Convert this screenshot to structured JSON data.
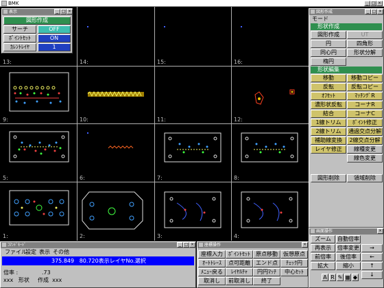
{
  "app": {
    "title": "BMK"
  },
  "canvas": {
    "cell_numbers": [
      "13:",
      "14:",
      "15:",
      "16:",
      "9:",
      "10:",
      "11:",
      "12:",
      "5:",
      "6:",
      "7:",
      "8:",
      "1:",
      "2:",
      "3:",
      "4:"
    ]
  },
  "zone_panel": {
    "title": "表示",
    "header": "図形作成",
    "rows": [
      {
        "label": "サーチ",
        "value": "OFF"
      },
      {
        "label": "ﾎﾟｲﾝﾄｾｯﾄ",
        "value": "ON"
      },
      {
        "label": "ｶﾚﾝﾄﾚｲﾔ",
        "value": "1"
      }
    ]
  },
  "shape_panel": {
    "title": "図形作成",
    "mode_label": "モード",
    "section1": "形状作成",
    "buttons1": [
      [
        "図形作成",
        "UT"
      ],
      [
        "円",
        "四角形"
      ],
      [
        "同心円",
        "形状分解"
      ],
      [
        "楕円",
        ""
      ]
    ],
    "section2": "形状編集",
    "buttons2": [
      [
        "移動",
        "移動コピー"
      ],
      [
        "反転",
        "反転コピー"
      ],
      [
        "ｵﾌｾｯﾄ",
        "ﾏｯﾁﾝｸﾞR"
      ],
      [
        "濃形状反転",
        "コーナR"
      ],
      [
        "結合",
        "コーナC"
      ],
      [
        "1線トリム",
        "ﾎﾟｲﾝﾄ修正"
      ],
      [
        "2線トリム",
        "通過交点分解"
      ],
      [
        "補助線変換",
        "2線交点分解"
      ],
      [
        "レイヤ修正",
        "線種変更"
      ],
      [
        "",
        "線色変更"
      ]
    ],
    "bottom_buttons": [
      "図形削除",
      "領域削除"
    ]
  },
  "screen_panel": {
    "title": "画面操作",
    "buttons": [
      [
        "ズーム",
        "自動倍率"
      ],
      [
        "再表示",
        "倍率変更"
      ],
      [
        "前倍率",
        "後倍率"
      ],
      [
        "拡大",
        "縮小"
      ]
    ],
    "arrows": [
      "→",
      "←",
      "↑",
      "↓"
    ]
  },
  "coord_panel": {
    "title": "ｺﾏﾝﾄﾞﾓｰﾄﾞ",
    "menu": [
      "ファイル",
      "設定",
      "表示",
      "その他"
    ],
    "status_line": "375.849   80.720表示レイヤNo.選択",
    "zoom_label": "倍率 :",
    "zoom_value": ".73",
    "shape_label": "xxx   形状",
    "shape_value": "作成  xxx"
  },
  "input_panel": {
    "title": "座標操作",
    "buttons": [
      [
        "座標入力",
        "ﾎﾟｲﾝﾄｾｯﾄ",
        "原点移動",
        "仮想原点"
      ],
      [
        "ｵｰﾄﾄﾚｰｽ",
        "点可距離",
        "エンド点",
        "ﾁｪｯｸ円"
      ],
      [
        "ﾒﾆｭｰ戻る",
        "ﾚｲﾔﾙﾁｬ",
        "円円ﾏｯﾁ",
        "中心ｾｯﾄ"
      ],
      [
        "取消し",
        "前取消し",
        "終了",
        ""
      ]
    ]
  },
  "colors": {
    "bg": "#000000",
    "panel": "#c0c0c0",
    "accent_green": "#2f8f4f",
    "accent_cyan": "#3fbfb0",
    "accent_blue": "#2040c0",
    "yellow_btn": "#cfc36b",
    "status_blue": "#0000ff"
  }
}
